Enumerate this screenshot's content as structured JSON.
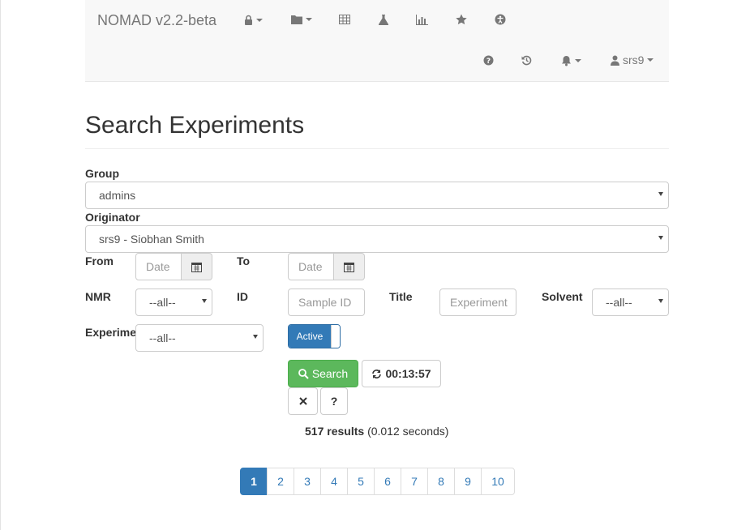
{
  "navbar": {
    "brand": "NOMAD v2.2-beta",
    "user": "srs9"
  },
  "page": {
    "title": "Search Experiments"
  },
  "form": {
    "group_label": "Group",
    "group_value": "admins",
    "originator_label": "Originator",
    "originator_value": "srs9 - Siobhan Smith",
    "from_label": "From",
    "from_placeholder": "Date",
    "to_label": "To",
    "to_placeholder": "Date",
    "nmr_label": "NMR",
    "nmr_value": "--all--",
    "id_label": "ID",
    "id_placeholder": "Sample ID",
    "title_label": "Title",
    "title_placeholder": "Experiment",
    "solvent_label": "Solvent",
    "solvent_value": "--all--",
    "experiment_label": "Experime",
    "experiment_value": "--all--",
    "toggle_label": "Active"
  },
  "actions": {
    "search_label": "Search",
    "refresh_timer": "00:13:57",
    "help_label": "?"
  },
  "results": {
    "count": "517 results",
    "time": "(0.012 seconds)"
  },
  "pagination": {
    "pages": [
      "1",
      "2",
      "3",
      "4",
      "5",
      "6",
      "7",
      "8",
      "9",
      "10"
    ],
    "active": "1"
  },
  "colors": {
    "primary": "#337ab7",
    "success": "#5cb85c",
    "navbar_bg": "#f8f8f8"
  }
}
